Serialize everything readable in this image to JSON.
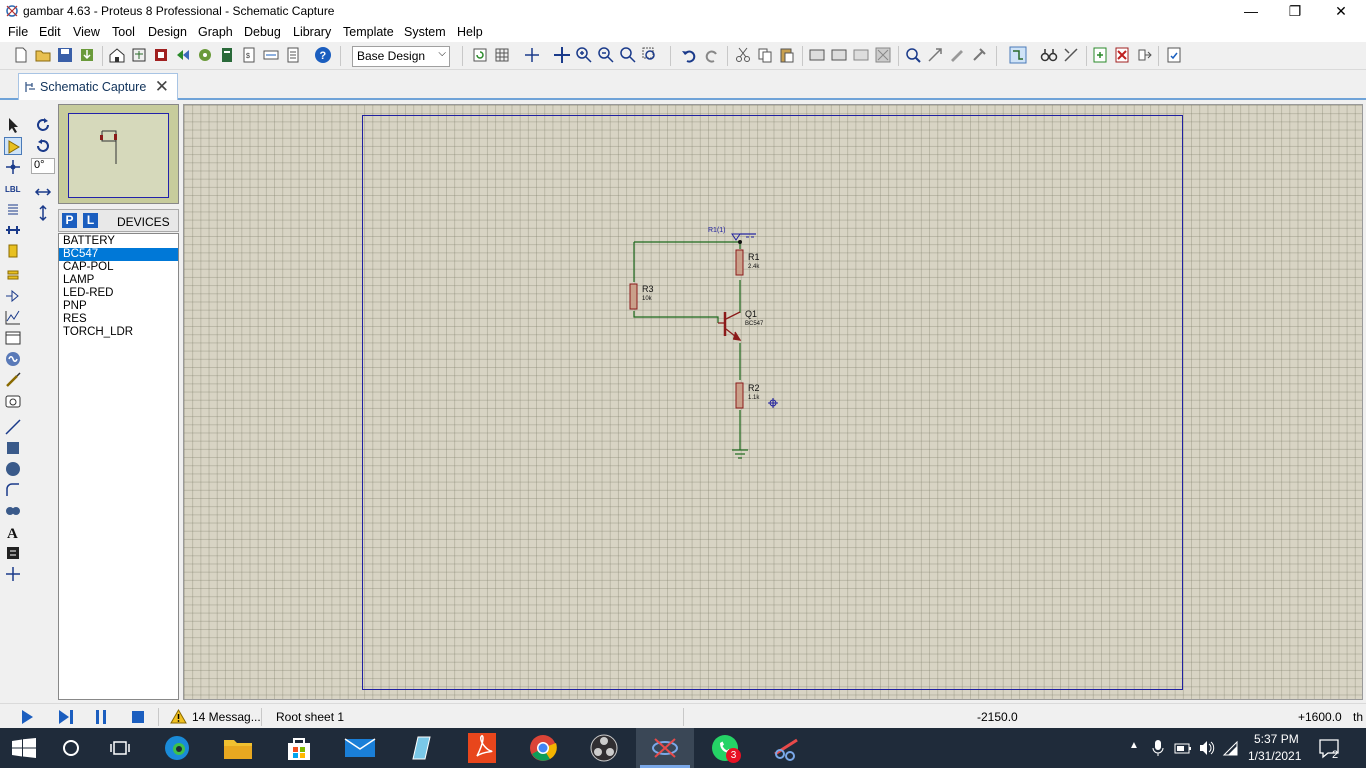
{
  "window": {
    "title": "gambar  4.63 - Proteus 8 Professional - Schematic Capture",
    "minimize_glyph": "—",
    "maximize_glyph": "❐",
    "close_glyph": "✕"
  },
  "menu": [
    "File",
    "Edit",
    "View",
    "Tool",
    "Design",
    "Graph",
    "Debug",
    "Library",
    "Template",
    "System",
    "Help"
  ],
  "toolbar": {
    "design_select_value": "Base Design"
  },
  "tab": {
    "label": "Schematic Capture"
  },
  "rotation": {
    "angle_value": "0°"
  },
  "devices": {
    "p_button": "P",
    "l_button": "L",
    "header": "DEVICES",
    "items": [
      "BATTERY",
      "BC547",
      "CAP-POL",
      "LAMP",
      "LED-RED",
      "PNP",
      "RES",
      "TORCH_LDR"
    ],
    "selected": "BC547"
  },
  "schematic": {
    "probe_label": "R1(1)",
    "r1_name": "R1",
    "r1_value": "2.4k",
    "r3_name": "R3",
    "r3_value": "10k",
    "q1_name": "Q1",
    "q1_value": "BC547",
    "r2_name": "R2",
    "r2_value": "1.1k"
  },
  "status": {
    "messages": "14 Messag...",
    "sheet": "Root sheet 1",
    "coord_x": "-2150.0",
    "coord_y": "+1600.0",
    "units": "th"
  },
  "taskbar": {
    "whatsapp_badge": "3",
    "time": "5:37 PM",
    "date": "1/31/2021",
    "notification_count": "2"
  },
  "colors": {
    "canvas_bg": "#d8d4c4",
    "wire": "#1f6b1f",
    "component": "#8b1a1a",
    "sheet_border": "#2020a0",
    "selection": "#0078d7",
    "taskbar": "#1f2b3a"
  }
}
